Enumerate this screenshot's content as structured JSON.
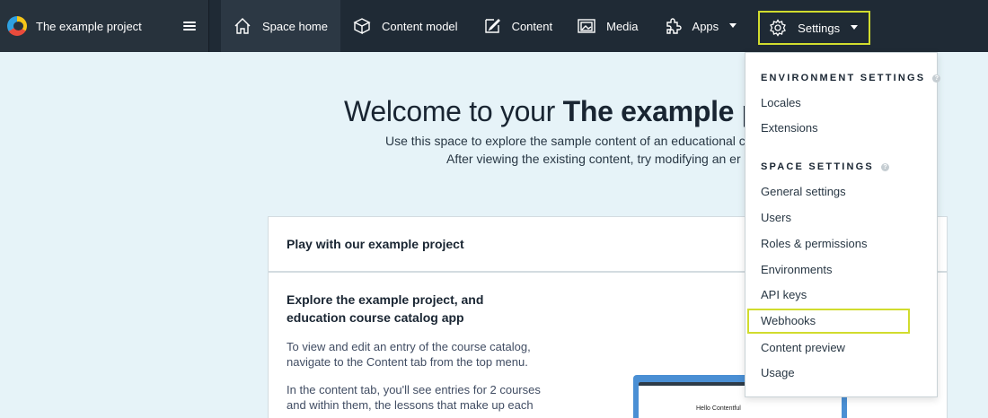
{
  "project": {
    "name": "The example project"
  },
  "nav": {
    "space_home": "Space home",
    "content_model": "Content model",
    "content": "Content",
    "media": "Media",
    "apps": "Apps",
    "settings": "Settings"
  },
  "welcome": {
    "title_prefix": "Welcome to your ",
    "title_bold": "The example pro",
    "line1": "Use this space to explore the sample content of an educational c",
    "line2": "After viewing the existing content, try modifying an er"
  },
  "card": {
    "header": "Play with our example project",
    "heading": "Explore the example project, and education course catalog app",
    "p1": "To view and edit an entry of the course catalog, navigate to the Content tab from the top menu.",
    "p2": "In the content tab, you'll see entries for 2 courses and within them, the lessons that make up each course.",
    "preview_caption": "Hello Contentful"
  },
  "dropdown": {
    "environment_settings": "ENVIRONMENT SETTINGS",
    "locales": "Locales",
    "extensions": "Extensions",
    "space_settings": "SPACE SETTINGS",
    "general_settings": "General settings",
    "users": "Users",
    "roles_permissions": "Roles & permissions",
    "environments": "Environments",
    "api_keys": "API keys",
    "webhooks": "Webhooks",
    "content_preview": "Content preview",
    "usage": "Usage"
  },
  "colors": {
    "topbar": "#1f2a35",
    "page_background": "#e6f3f8",
    "highlight": "#d1dc2e"
  },
  "icons": [
    "menu-icon",
    "home-icon",
    "content-model-icon",
    "content-icon",
    "media-icon",
    "apps-icon",
    "gear-icon",
    "chevron-down-icon",
    "help-icon"
  ]
}
